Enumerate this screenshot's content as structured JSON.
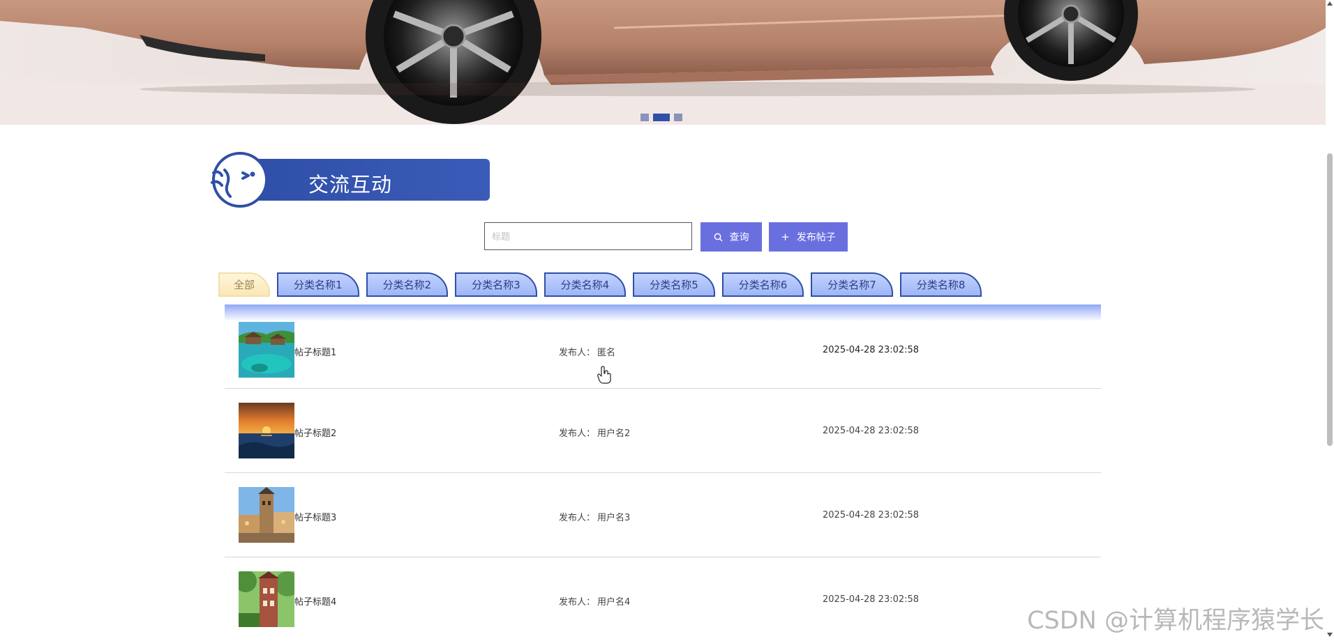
{
  "banner": {
    "slides": 3,
    "active_slide": 2
  },
  "section": {
    "title": "交流互动"
  },
  "search": {
    "placeholder": "标题",
    "search_label": "查询",
    "post_label": "发布帖子"
  },
  "categories": [
    {
      "label": "全部",
      "active": true
    },
    {
      "label": "分类名称1"
    },
    {
      "label": "分类名称2"
    },
    {
      "label": "分类名称3"
    },
    {
      "label": "分类名称4"
    },
    {
      "label": "分类名称5"
    },
    {
      "label": "分类名称6"
    },
    {
      "label": "分类名称7"
    },
    {
      "label": "分类名称8"
    }
  ],
  "posts": [
    {
      "title": "帖子标题1",
      "author_label": "发布人：",
      "author": "匿名",
      "time": "2025-04-28 23:02:58",
      "image": "tropical-lagoon"
    },
    {
      "title": "帖子标题2",
      "author_label": "发布人：",
      "author": "用户名2",
      "time": "2025-04-28 23:02:58",
      "image": "sunset-sea"
    },
    {
      "title": "帖子标题3",
      "author_label": "发布人：",
      "author": "用户名3",
      "time": "2025-04-28 23:02:58",
      "image": "old-town-tower"
    },
    {
      "title": "帖子标题4",
      "author_label": "发布人：",
      "author": "用户名4",
      "time": "2025-04-28 23:02:58",
      "image": "castle-trees"
    }
  ],
  "watermark": "CSDN @计算机程序猿学长",
  "colors": {
    "primary": "#2f4fa8",
    "button": "#6a6fe0",
    "tab_bg": "#b0c4fa",
    "tab_all_bg": "#fbe7b6"
  }
}
